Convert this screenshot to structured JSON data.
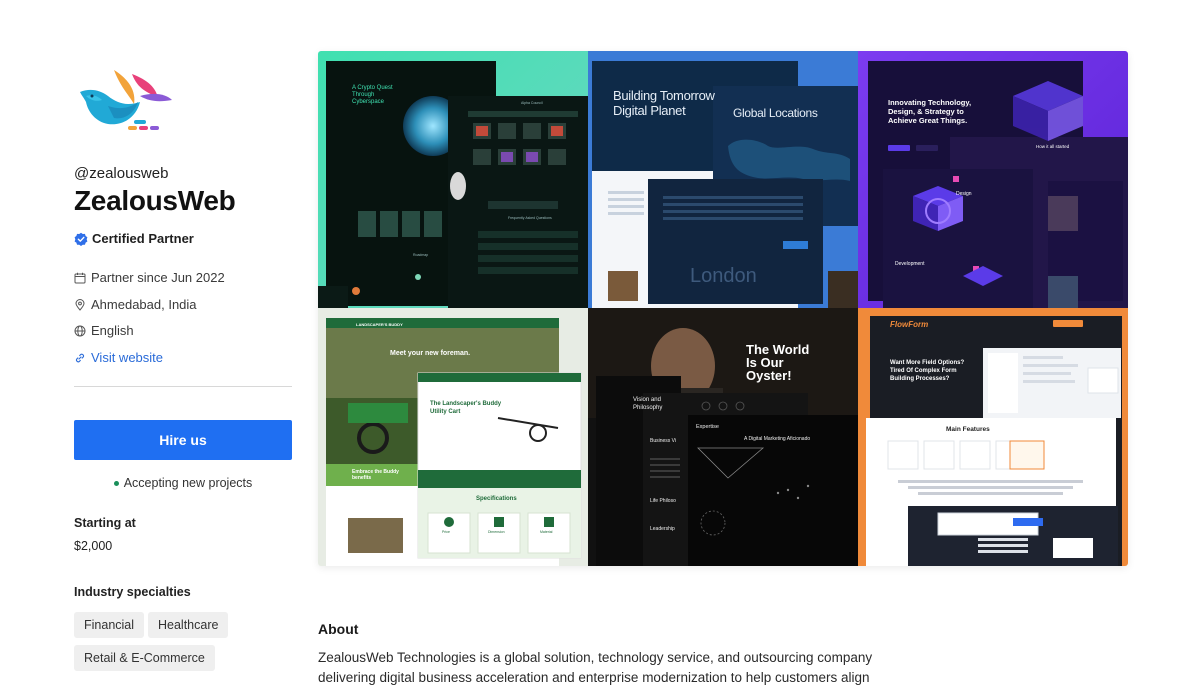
{
  "profile": {
    "handle": "@zealousweb",
    "name": "ZealousWeb",
    "certification": "Certified Partner",
    "partner_since": "Partner since Jun 2022",
    "location": "Ahmedabad, India",
    "language": "English",
    "website_label": "Visit website",
    "hire_label": "Hire us",
    "availability": "Accepting new projects",
    "starting_label": "Starting at",
    "starting_value": "$2,000",
    "industry_label": "Industry specialties",
    "industries": [
      "Financial",
      "Healthcare",
      "Retail & E-Commerce"
    ]
  },
  "colors": {
    "accent": "#1f6ff2",
    "link": "#2a6bd8",
    "status_green": "#1a8f5a",
    "tag_bg": "#efefef"
  },
  "gallery": {
    "tiles": [
      {
        "texts": [
          "A Crypto Quest",
          "Through",
          "Cyberspace",
          "Alpha Council",
          "Frequently Asked Questions",
          "Roadmap"
        ]
      },
      {
        "texts": [
          "Building Tomorrow",
          "Digital Planet",
          "Global Locations",
          "London"
        ]
      },
      {
        "texts": [
          "Innovating Technology,",
          "Design, & Strategy to",
          "Achieve Great Things.",
          "Design",
          "Development",
          "How it all started"
        ]
      },
      {
        "texts": [
          "LANDSCAPER'S BUDDY",
          "Meet your new foreman.",
          "The Landscaper's Buddy",
          "Utility Cart",
          "Embrace the Buddy",
          "benefits",
          "Specifications",
          "Price",
          "Dimension",
          "Material"
        ]
      },
      {
        "texts": [
          "The World",
          "Is Our",
          "Oyster!",
          "Vision and",
          "Philosophy",
          "Expertise",
          "A Digital Marketing Aficionado",
          "Business Vi",
          "Life Philoso",
          "Leadership"
        ]
      },
      {
        "texts": [
          "FlowForm",
          "Want More Field Options?",
          "Tired Of Complex Form",
          "Building Processes?",
          "Main Features"
        ]
      }
    ]
  },
  "about": {
    "title": "About",
    "text": "ZealousWeb Technologies is a global solution, technology service, and outsourcing company delivering digital business acceleration and enterprise modernization to help customers align"
  }
}
